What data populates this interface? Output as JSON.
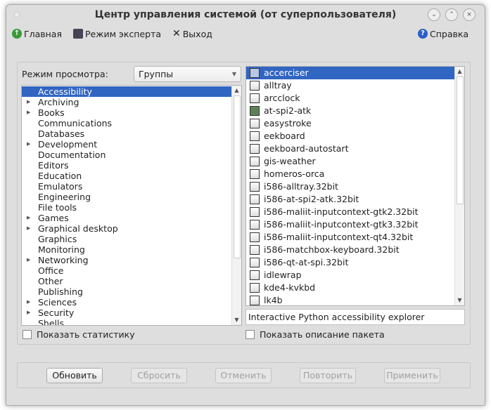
{
  "window": {
    "title": "Центр управления системой (от суперпользователя)",
    "minimize": "⌄",
    "maximize": "⌃",
    "close": "×"
  },
  "toolbar": {
    "home": "Главная",
    "expert": "Режим эксперта",
    "exit": "Выход",
    "help": "Справка"
  },
  "view_mode": {
    "label": "Режим просмотра:",
    "value": "Группы"
  },
  "groups": [
    {
      "label": "Accessibility",
      "expandable": false,
      "selected": true
    },
    {
      "label": "Archiving",
      "expandable": true
    },
    {
      "label": "Books",
      "expandable": true
    },
    {
      "label": "Communications",
      "expandable": false
    },
    {
      "label": "Databases",
      "expandable": false
    },
    {
      "label": "Development",
      "expandable": true
    },
    {
      "label": "Documentation",
      "expandable": false
    },
    {
      "label": "Editors",
      "expandable": false
    },
    {
      "label": "Education",
      "expandable": false
    },
    {
      "label": "Emulators",
      "expandable": false
    },
    {
      "label": "Engineering",
      "expandable": false
    },
    {
      "label": "File tools",
      "expandable": false
    },
    {
      "label": "Games",
      "expandable": true
    },
    {
      "label": "Graphical desktop",
      "expandable": true
    },
    {
      "label": "Graphics",
      "expandable": false
    },
    {
      "label": "Monitoring",
      "expandable": false
    },
    {
      "label": "Networking",
      "expandable": true
    },
    {
      "label": "Office",
      "expandable": false
    },
    {
      "label": "Other",
      "expandable": false
    },
    {
      "label": "Publishing",
      "expandable": false
    },
    {
      "label": "Sciences",
      "expandable": true
    },
    {
      "label": "Security",
      "expandable": true
    },
    {
      "label": "Shells",
      "expandable": false
    }
  ],
  "packages": [
    {
      "name": "accerciser",
      "installed": false,
      "selected": true
    },
    {
      "name": "alltray",
      "installed": false
    },
    {
      "name": "arcclock",
      "installed": false
    },
    {
      "name": "at-spi2-atk",
      "installed": true
    },
    {
      "name": "easystroke",
      "installed": false
    },
    {
      "name": "eekboard",
      "installed": false
    },
    {
      "name": "eekboard-autostart",
      "installed": false
    },
    {
      "name": "gis-weather",
      "installed": false
    },
    {
      "name": "homeros-orca",
      "installed": false
    },
    {
      "name": "i586-alltray.32bit",
      "installed": false
    },
    {
      "name": "i586-at-spi2-atk.32bit",
      "installed": false
    },
    {
      "name": "i586-maliit-inputcontext-gtk2.32bit",
      "installed": false
    },
    {
      "name": "i586-maliit-inputcontext-gtk3.32bit",
      "installed": false
    },
    {
      "name": "i586-maliit-inputcontext-qt4.32bit",
      "installed": false
    },
    {
      "name": "i586-matchbox-keyboard.32bit",
      "installed": false
    },
    {
      "name": "i586-qt-at-spi.32bit",
      "installed": false
    },
    {
      "name": "idlewrap",
      "installed": false
    },
    {
      "name": "kde4-kvkbd",
      "installed": false
    },
    {
      "name": "lk4b",
      "installed": false
    }
  ],
  "description": "Interactive Python accessibility explorer",
  "show_stats": {
    "label": "Показать статистику",
    "checked": false
  },
  "show_desc": {
    "label": "Показать описание пакета",
    "checked": false
  },
  "buttons": {
    "refresh": "Обновить",
    "reset": "Сбросить",
    "cancel": "Отменить",
    "redo": "Повторить",
    "apply": "Применить"
  },
  "colors": {
    "selection": "#3165c2",
    "installed": "#5f7f58"
  }
}
